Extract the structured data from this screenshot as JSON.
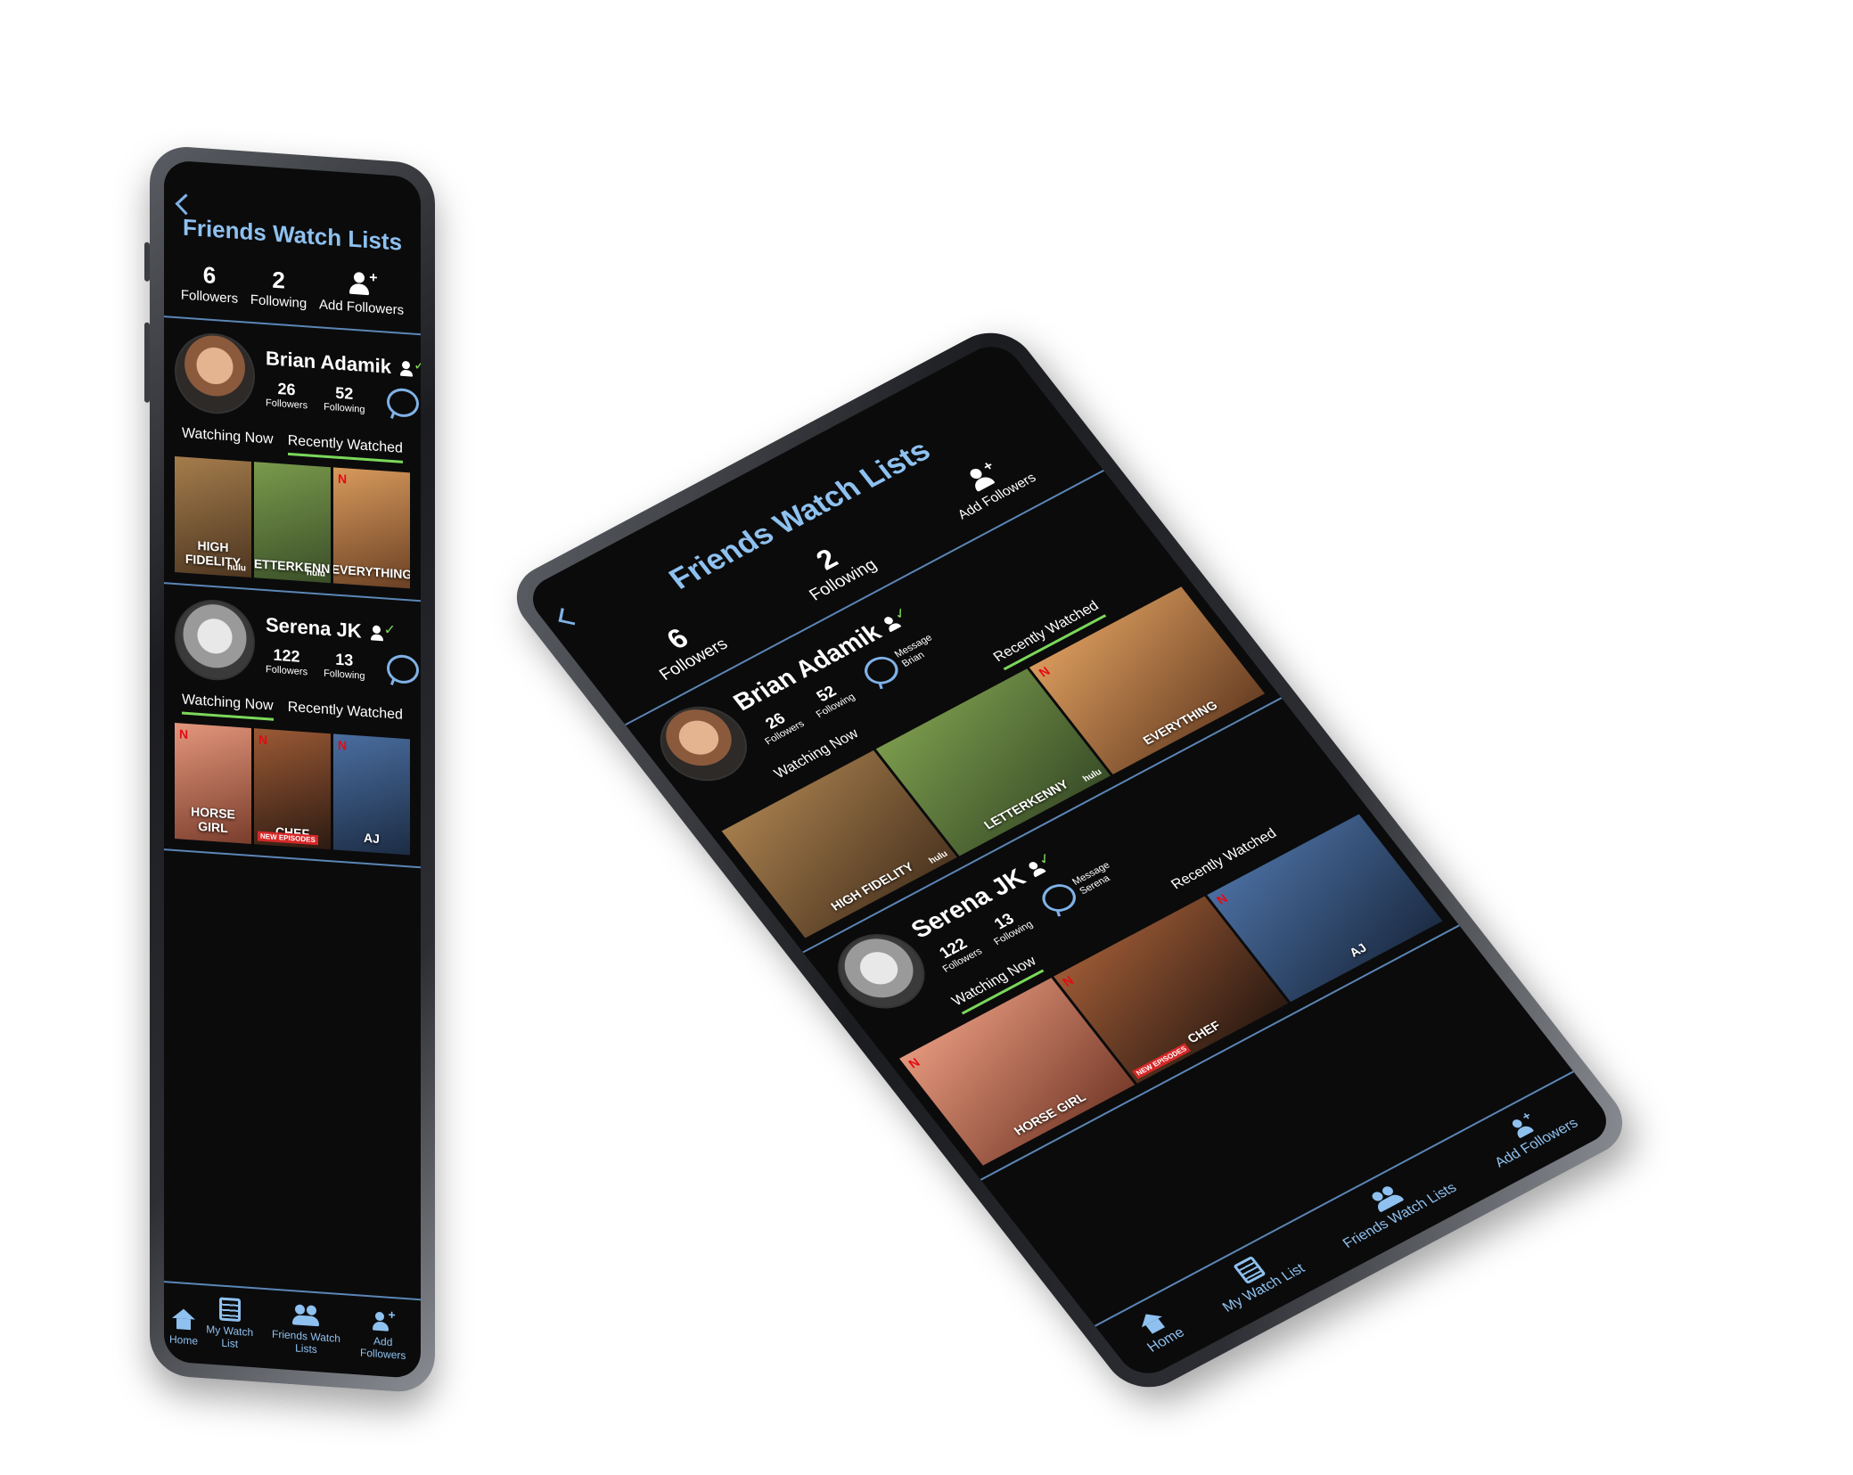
{
  "header": {
    "title": "Friends Watch Lists"
  },
  "stats": {
    "followers_count": "6",
    "followers_label": "Followers",
    "following_count": "2",
    "following_label": "Following",
    "add_followers_label": "Add Followers"
  },
  "friends": [
    {
      "name": "Brian Adamik",
      "followers": "26",
      "followers_label": "Followers",
      "following": "52",
      "following_label": "Following",
      "message_label_1": "Message",
      "message_label_2": "Brian",
      "tab_watching": "Watching Now",
      "tab_recent": "Recently Watched",
      "posters": [
        {
          "title": "HIGH FIDELITY",
          "brand": "hulu",
          "color": "#8b6a3e"
        },
        {
          "title": "LETTERKENNY",
          "brand": "hulu",
          "color": "#5f7a3c"
        },
        {
          "title": "EVERYTHING",
          "brand": "N",
          "color": "#b57a3f"
        }
      ]
    },
    {
      "name": "Serena JK",
      "followers": "122",
      "followers_label": "Followers",
      "following": "13",
      "following_label": "Following",
      "message_label_1": "Message",
      "message_label_2": "Serena",
      "tab_watching": "Watching Now",
      "tab_recent": "Recently Watched",
      "posters": [
        {
          "title": "HORSE GIRL",
          "brand": "N",
          "color": "#c2765e"
        },
        {
          "title": "CHEF",
          "badge": "NEW EPISODES",
          "brand": "N",
          "color": "#6b3a25"
        },
        {
          "title": "AJ",
          "brand": "N",
          "color": "#2f4e7a"
        }
      ]
    }
  ],
  "nav": {
    "home": "Home",
    "watch_list": "My Watch List",
    "friends": "Friends Watch Lists",
    "add": "Add Followers"
  },
  "icons": [
    "back-icon",
    "add-user-icon",
    "friend-check-icon",
    "chat-icon",
    "home-icon",
    "list-icon",
    "friends-icon",
    "add-followers-icon"
  ],
  "colors": {
    "accent_blue": "#8ec1ef",
    "active_tab": "#7bd85a",
    "screen_bg": "#0b0b0c"
  }
}
